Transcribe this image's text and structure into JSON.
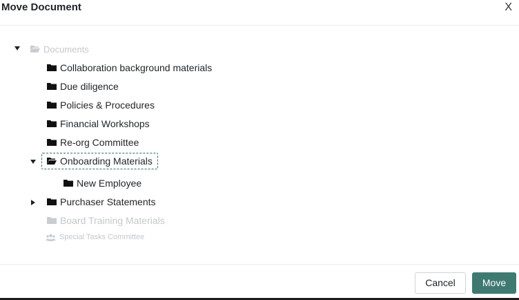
{
  "dialog": {
    "title": "Move Document",
    "close_label": "X"
  },
  "tree": {
    "root": {
      "label": "Documents",
      "expanded": true,
      "disabled": true
    },
    "items": [
      {
        "label": "Collaboration background materials"
      },
      {
        "label": "Due diligence"
      },
      {
        "label": "Policies & Procedures"
      },
      {
        "label": "Financial Workshops"
      },
      {
        "label": "Re-org Committee"
      },
      {
        "label": "Onboarding Materials",
        "expanded": true,
        "selected": true
      },
      {
        "label": "New Employee"
      },
      {
        "label": "Purchaser Statements",
        "expanded": false
      },
      {
        "label": "Board Training Materials",
        "disabled": true
      },
      {
        "label": "Special Tasks Committee",
        "disabled": true
      }
    ]
  },
  "footer": {
    "cancel_label": "Cancel",
    "move_label": "Move"
  },
  "colors": {
    "primary": "#3f7a72",
    "selection_border": "#2f6f6a",
    "disabled_text": "#c4c8cc"
  }
}
